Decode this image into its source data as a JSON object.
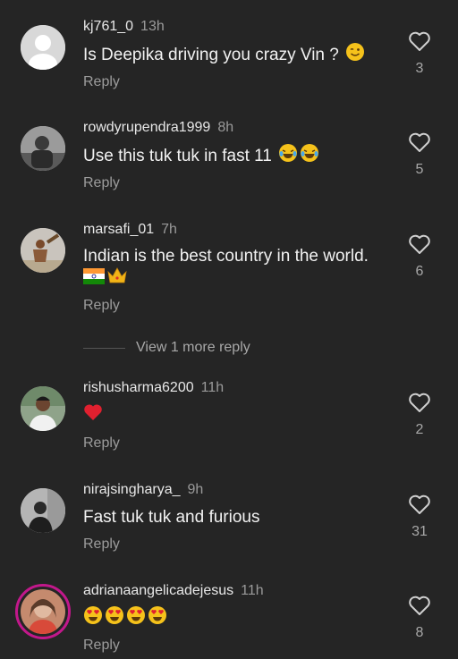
{
  "comments": [
    {
      "username": "kj761_0",
      "time": "13h",
      "text": "Is Deepika driving you crazy Vin ?",
      "reply": "Reply",
      "likes": "3",
      "emojis": [
        "wink"
      ]
    },
    {
      "username": "rowdyrupendra1999",
      "time": "8h",
      "text": "Use this tuk tuk in fast 11",
      "reply": "Reply",
      "likes": "5",
      "emojis": [
        "joy",
        "joy"
      ]
    },
    {
      "username": "marsafi_01",
      "time": "7h",
      "text": "Indian is the best country in the world.",
      "reply": "Reply",
      "likes": "6",
      "emojis": [
        "india-flag",
        "crown"
      ]
    },
    {
      "username": "rishusharma6200",
      "time": "11h",
      "text": "",
      "reply": "Reply",
      "likes": "2",
      "emojis": [
        "red-heart"
      ]
    },
    {
      "username": "nirajsingharya_",
      "time": "9h",
      "text": "Fast tuk tuk and furious",
      "reply": "Reply",
      "likes": "31",
      "emojis": []
    },
    {
      "username": "adrianaangelicadejesus",
      "time": "11h",
      "text": "",
      "reply": "Reply",
      "likes": "8",
      "emojis": [
        "heart-eyes",
        "heart-eyes",
        "heart-eyes",
        "heart-eyes"
      ]
    }
  ],
  "view_more": {
    "label": "View 1 more reply"
  },
  "icons": {
    "like": "heart-outline-icon"
  },
  "colors": {
    "background": "#252525",
    "story_ring": "#c2188b",
    "secondary_text": "#9c9c9c"
  }
}
